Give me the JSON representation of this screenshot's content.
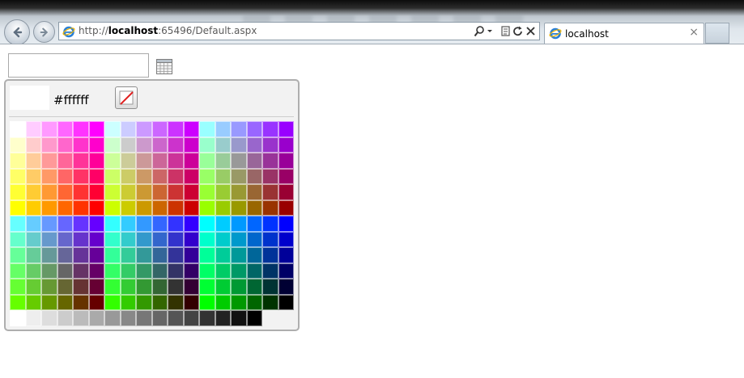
{
  "browser": {
    "address": {
      "prefix": "http://",
      "host": "localhost",
      "rest": ":65496/Default.aspx"
    },
    "tab": {
      "title": "localhost",
      "close": "×"
    },
    "icons": [
      "back-icon",
      "forward-icon",
      "ie-icon",
      "search-icon",
      "compatibility-icon",
      "refresh-icon",
      "stop-icon",
      "close-icon"
    ]
  },
  "page": {
    "date_input": {
      "value": ""
    },
    "calendar_icon": "calendar-icon"
  },
  "color_picker": {
    "selected_color": "#ffffff",
    "selected_hex": "#ffffff",
    "clear_icon": "no-color-icon",
    "palette_rows": [
      [
        "#ffffff",
        "#ffccff",
        "#ff99ff",
        "#ff66ff",
        "#ff33ff",
        "#ff00ff",
        "#ccffff",
        "#ccccff",
        "#cc99ff",
        "#cc66ff",
        "#cc33ff",
        "#cc00ff",
        "#99ffff",
        "#99ccff",
        "#9999ff",
        "#9966ff",
        "#9933ff",
        "#9900ff"
      ],
      [
        "#ffffcc",
        "#ffcccc",
        "#ff99cc",
        "#ff66cc",
        "#ff33cc",
        "#ff00cc",
        "#ccffcc",
        "#cccccc",
        "#cc99cc",
        "#cc66cc",
        "#cc33cc",
        "#cc00cc",
        "#99ffcc",
        "#99cccc",
        "#9999cc",
        "#9966cc",
        "#9933cc",
        "#9900cc"
      ],
      [
        "#ffff99",
        "#ffcc99",
        "#ff9999",
        "#ff6699",
        "#ff3399",
        "#ff0099",
        "#ccff99",
        "#cccc99",
        "#cc9999",
        "#cc6699",
        "#cc3399",
        "#cc0099",
        "#99ff99",
        "#99cc99",
        "#999999",
        "#996699",
        "#993399",
        "#990099"
      ],
      [
        "#ffff66",
        "#ffcc66",
        "#ff9966",
        "#ff6666",
        "#ff3366",
        "#ff0066",
        "#ccff66",
        "#cccc66",
        "#cc9966",
        "#cc6666",
        "#cc3366",
        "#cc0066",
        "#99ff66",
        "#99cc66",
        "#999966",
        "#996666",
        "#993366",
        "#990066"
      ],
      [
        "#ffff33",
        "#ffcc33",
        "#ff9933",
        "#ff6633",
        "#ff3333",
        "#ff0033",
        "#ccff33",
        "#cccc33",
        "#cc9933",
        "#cc6633",
        "#cc3333",
        "#cc0033",
        "#99ff33",
        "#99cc33",
        "#999933",
        "#996633",
        "#993333",
        "#990033"
      ],
      [
        "#ffff00",
        "#ffcc00",
        "#ff9900",
        "#ff6600",
        "#ff3300",
        "#ff0000",
        "#ccff00",
        "#cccc00",
        "#cc9900",
        "#cc6600",
        "#cc3300",
        "#cc0000",
        "#99ff00",
        "#99cc00",
        "#999900",
        "#996600",
        "#993300",
        "#990000"
      ],
      [
        "#66ffff",
        "#66ccff",
        "#6699ff",
        "#6666ff",
        "#6633ff",
        "#6600ff",
        "#33ffff",
        "#33ccff",
        "#3399ff",
        "#3366ff",
        "#3333ff",
        "#3300ff",
        "#00ffff",
        "#00ccff",
        "#0099ff",
        "#0066ff",
        "#0033ff",
        "#0000ff"
      ],
      [
        "#66ffcc",
        "#66cccc",
        "#6699cc",
        "#6666cc",
        "#6633cc",
        "#6600cc",
        "#33ffcc",
        "#33cccc",
        "#3399cc",
        "#3366cc",
        "#3333cc",
        "#3300cc",
        "#00ffcc",
        "#00cccc",
        "#0099cc",
        "#0066cc",
        "#0033cc",
        "#0000cc"
      ],
      [
        "#66ff99",
        "#66cc99",
        "#669999",
        "#666699",
        "#663399",
        "#660099",
        "#33ff99",
        "#33cc99",
        "#339999",
        "#336699",
        "#333399",
        "#330099",
        "#00ff99",
        "#00cc99",
        "#009999",
        "#006699",
        "#003399",
        "#000099"
      ],
      [
        "#66ff66",
        "#66cc66",
        "#669966",
        "#666666",
        "#663366",
        "#660066",
        "#33ff66",
        "#33cc66",
        "#339966",
        "#336666",
        "#333366",
        "#330066",
        "#00ff66",
        "#00cc66",
        "#009966",
        "#006666",
        "#003366",
        "#000066"
      ],
      [
        "#66ff33",
        "#66cc33",
        "#669933",
        "#666633",
        "#663333",
        "#660033",
        "#33ff33",
        "#33cc33",
        "#339933",
        "#336633",
        "#333333",
        "#330033",
        "#00ff33",
        "#00cc33",
        "#009933",
        "#006633",
        "#003333",
        "#000033"
      ],
      [
        "#66ff00",
        "#66cc00",
        "#669900",
        "#666600",
        "#663300",
        "#660000",
        "#33ff00",
        "#33cc00",
        "#339900",
        "#336600",
        "#333300",
        "#330000",
        "#00ff00",
        "#00cc00",
        "#009900",
        "#006600",
        "#003300",
        "#000000"
      ],
      [
        "#ffffff",
        "#eeeeee",
        "#dddddd",
        "#cccccc",
        "#bbbbbb",
        "#aaaaaa",
        "#999999",
        "#888888",
        "#777777",
        "#666666",
        "#555555",
        "#444444",
        "#333333",
        "#222222",
        "#111111",
        "#000000"
      ]
    ]
  }
}
